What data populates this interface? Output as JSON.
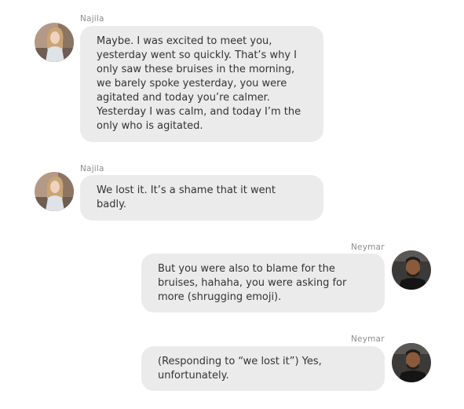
{
  "conversation": {
    "messages": [
      {
        "sender": "Najila",
        "side": "left",
        "avatar_icon": "woman-avatar",
        "lines": [
          "Maybe. I was excited to meet you,",
          "yesterday went so quickly. That’s why I",
          "only saw these bruises in the morning,",
          "we barely spoke yesterday, you were",
          "agitated and today you’re calmer.",
          "Yesterday I was calm, and today I’m the",
          "only who is agitated."
        ]
      },
      {
        "sender": "Najila",
        "side": "left",
        "avatar_icon": "woman-avatar",
        "lines": [
          "We lost it. It’s a shame that it went",
          "badly."
        ]
      },
      {
        "sender": "Neymar",
        "side": "right",
        "avatar_icon": "man-avatar",
        "lines": [
          "But you were also to blame for the",
          "bruises, hahaha, you were asking for",
          "more (shrugging emoji)."
        ]
      },
      {
        "sender": "Neymar",
        "side": "right",
        "avatar_icon": "man-avatar",
        "lines": [
          "(Responding to “we lost it”) Yes,",
          "unfortunately."
        ]
      }
    ]
  },
  "colors": {
    "bubble": "#ebebeb",
    "sender_label": "#8c8c8c",
    "text": "#333333"
  }
}
